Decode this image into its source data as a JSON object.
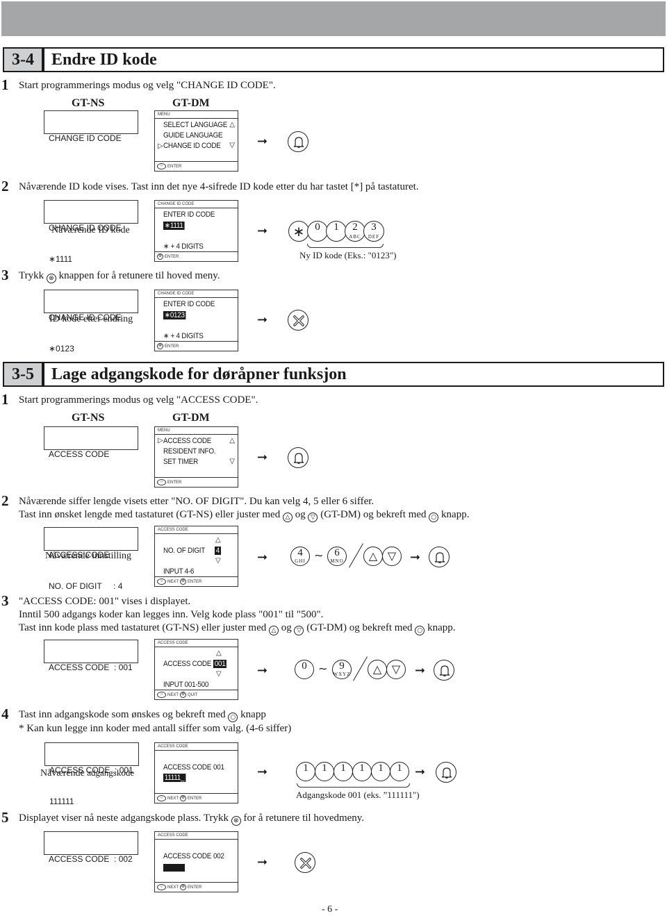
{
  "sections": [
    {
      "number": "3-4",
      "title": "Endre ID kode",
      "steps": [
        {
          "num": "1",
          "text": "Start programmerings modus og velg \"CHANGE ID CODE\".",
          "gt_ns_label": "GT-NS",
          "gt_dm_label": "GT-DM",
          "ns_display": [
            "CHANGE ID CODE"
          ],
          "dm_display": {
            "header": "MENU",
            "items": [
              "SELECT LANGUAGE",
              "GUIDE LANGUAGE",
              "CHANGE ID CODE"
            ],
            "selected_index": 2,
            "footer": "ENTER"
          },
          "action_icon": "bell-icon"
        },
        {
          "num": "2",
          "text": "Nåværende ID kode vises. Tast inn det nye 4-sifrede ID kode etter du har tastet [*] på tastaturet.",
          "ns_display": [
            "CHANGE ID CODE",
            "∗1111"
          ],
          "ns_caption": "Nåværende ID kode",
          "dm_display": {
            "header": "CHANGE ID CODE",
            "line1": "ENTER ID CODE",
            "value": "∗1111",
            "hint": "∗ + 4 DIGITS",
            "footer": "ENTER"
          },
          "keys": [
            {
              "main": "∗",
              "sub": ""
            },
            {
              "main": "0",
              "sub": ""
            },
            {
              "main": "1",
              "sub": ""
            },
            {
              "main": "2",
              "sub": "ABC"
            },
            {
              "main": "3",
              "sub": "DEF"
            }
          ],
          "keys_caption": "Ny ID kode (Eks.: \"0123\")"
        },
        {
          "num": "3",
          "text_before": "Trykk",
          "text_after": "knappen for å retunere til hoved meny.",
          "ns_display": [
            "CHANGE ID CODE",
            "∗0123"
          ],
          "ns_caption": "ID kode etter endring",
          "dm_display": {
            "header": "CHANGE ID CODE",
            "line1": "ENTER ID CODE",
            "value": "∗0123",
            "hint": "∗ + 4 DIGITS",
            "footer": "ENTER"
          },
          "action_icon": "cancel-x-icon"
        }
      ]
    },
    {
      "number": "3-5",
      "title": "Lage adgangskode for døråpner funksjon",
      "steps": [
        {
          "num": "1",
          "text": "Start programmerings modus og velg \"ACCESS CODE\".",
          "gt_ns_label": "GT-NS",
          "gt_dm_label": "GT-DM",
          "ns_display": [
            "ACCESS CODE"
          ],
          "dm_display": {
            "header": "MENU",
            "items": [
              "ACCESS CODE",
              "RESIDENT INFO.",
              "SET TIMER"
            ],
            "selected_index": 0,
            "footer": "ENTER"
          },
          "action_icon": "bell-icon"
        },
        {
          "num": "2",
          "text_line1": "Nåværende siffer lengde visets etter \"NO. OF DIGIT\". Du kan velg 4, 5 eller 6 siffer.",
          "text_line2_a": "Tast inn ønsket lengde med tastaturet (GT-NS) eller juster med",
          "text_line2_b": "og",
          "text_line2_c": "(GT-DM) og bekreft med",
          "text_line2_d": "knapp.",
          "ns_display": [
            "ACCESS CODE",
            "NO. OF DIGIT     : 4"
          ],
          "ns_caption": "Nåværende innstilling",
          "dm_display": {
            "header": "ACCESS CODE",
            "label": "NO. OF DIGIT",
            "value": "4",
            "hint": "INPUT 4-6",
            "footer_next": "NEXT",
            "footer_action": "ENTER"
          },
          "keys": [
            {
              "main": "4",
              "sub": "GHI"
            },
            {
              "main": "6",
              "sub": "MNO"
            }
          ]
        },
        {
          "num": "3",
          "text_line1": "\"ACCESS CODE: 001\" vises i displayet.",
          "text_line2": "Inntil 500 adgangs koder kan legges inn. Velg kode plass \"001\" til \"500\".",
          "text_line3_a": "Tast inn kode plass med tastaturet (GT-NS) eller juster med",
          "text_line3_b": "og",
          "text_line3_c": "(GT-DM) og bekreft med",
          "text_line3_d": "knapp.",
          "ns_display": [
            "ACCESS CODE  : 001"
          ],
          "dm_display": {
            "header": "ACCESS CODE",
            "label": "ACCESS CODE",
            "value": "001",
            "hint": "INPUT 001-500",
            "footer_next": "NEXT",
            "footer_action": "QUIT"
          },
          "keys": [
            {
              "main": "0",
              "sub": ""
            },
            {
              "main": "9",
              "sub": "WXYZ"
            }
          ]
        },
        {
          "num": "4",
          "text_line1_a": "Tast inn adgangskode som ønskes og bekreft med",
          "text_line1_b": "knapp",
          "text_line2": "* Kan kun legge inn koder med antall siffer som valg. (4-6 siffer)",
          "ns_display": [
            "ACCESS CODE  : 001",
            "111111"
          ],
          "ns_caption_a": "Nåværende",
          "ns_caption_b": "adgangskode",
          "dm_display": {
            "header": "ACCESS CODE",
            "label": "ACCESS CODE",
            "code": "001",
            "value": "11111_",
            "footer_next": "NEXT",
            "footer_action": "ENTER"
          },
          "keys": [
            "1",
            "1",
            "1",
            "1",
            "1",
            "1"
          ],
          "keys_caption": "Adgangskode 001 (eks. ”111111\")"
        },
        {
          "num": "5",
          "text_before": "Displayet viser nå neste adgangskode plass. Trykk",
          "text_after": "for å retunere til hovedmeny.",
          "ns_display": [
            "ACCESS CODE  : 002"
          ],
          "dm_display": {
            "header": "ACCESS CODE",
            "label": "ACCESS CODE",
            "code": "002",
            "footer_next": "NEXT",
            "footer_action": "ENTER"
          },
          "action_icon": "cancel-x-icon"
        }
      ]
    }
  ],
  "page_number": "- 6 -",
  "arrow_glyph": "➞",
  "tilde_glyph": "∼",
  "up_glyph": "△",
  "down_glyph": "▽",
  "sel_glyph": "▷",
  "x_glyph": "⊗",
  "bell_glyph": "⍾"
}
